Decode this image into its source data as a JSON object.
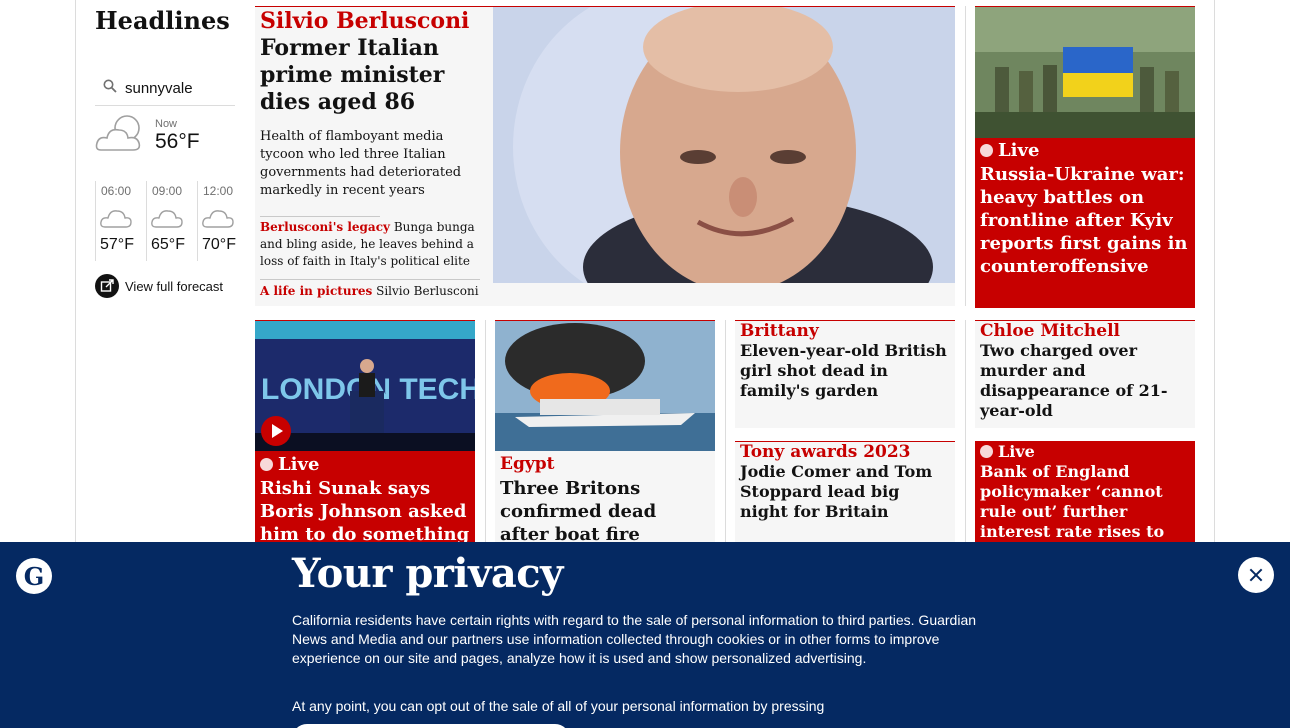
{
  "section": {
    "title": "Headlines"
  },
  "weather": {
    "location_value": "sunnyvale",
    "now_label": "Now",
    "now_temp": "56°F",
    "forecast": [
      {
        "time": "06:00",
        "temp": "57°F"
      },
      {
        "time": "09:00",
        "temp": "65°F"
      },
      {
        "time": "12:00",
        "temp": "70°F"
      }
    ],
    "full_forecast_label": "View full forecast"
  },
  "lead": {
    "kicker": "Silvio Berlusconi",
    "headline": "Former Italian prime minister dies aged 86",
    "standfirst": "Health of flamboyant media tycoon who led three Italian governments had deteriorated markedly in recent years",
    "related": [
      {
        "kicker": "Berlusconi's legacy",
        "text": "Bunga bunga and bling aside, he leaves behind a loss of faith in Italy's political elite"
      },
      {
        "kicker": "A life in pictures",
        "text": "Silvio Berlusconi"
      }
    ]
  },
  "ukraine": {
    "live_label": "Live",
    "headline": "Russia-Ukraine war: heavy battles on frontline after Kyiv reports first gains in counteroffensive"
  },
  "row2": {
    "sunak": {
      "live_label": "Live",
      "headline": "Rishi Sunak says Boris Johnson asked him to do something he"
    },
    "egypt": {
      "kicker": "Egypt",
      "headline": "Three Britons confirmed dead after boat fire"
    },
    "brittany": {
      "kicker": "Brittany",
      "headline": "Eleven-year-old British girl shot dead in family's garden"
    },
    "tony": {
      "kicker": "Tony awards 2023",
      "headline": "Jodie Comer and Tom Stoppard lead big night for Britain"
    },
    "chloe": {
      "kicker": "Chloe Mitchell",
      "headline": "Two charged over murder and disappearance of 21-year-old"
    },
    "boe": {
      "live_label": "Live",
      "headline": "Bank of England policymaker ‘cannot rule out’ further interest rate rises to fight inflation"
    }
  },
  "privacy": {
    "logo_letter": "G",
    "title": "Your privacy",
    "body": "California residents have certain rights with regard to the sale of personal information to third parties. Guardian News and Media and our partners use information collected through cookies or in other forms to improve experience on our site and pages, analyze how it is used and show personalized advertising.",
    "body2": "At any point, you can opt out of the sale of all of your personal information by pressing"
  },
  "colors": {
    "news_red": "#c70000",
    "guardian_blue": "#052962",
    "card_grey": "#f6f6f6"
  },
  "icons": [
    "search-icon",
    "cloud-icon",
    "external-link-icon",
    "play-icon",
    "live-dot-icon",
    "close-icon"
  ]
}
